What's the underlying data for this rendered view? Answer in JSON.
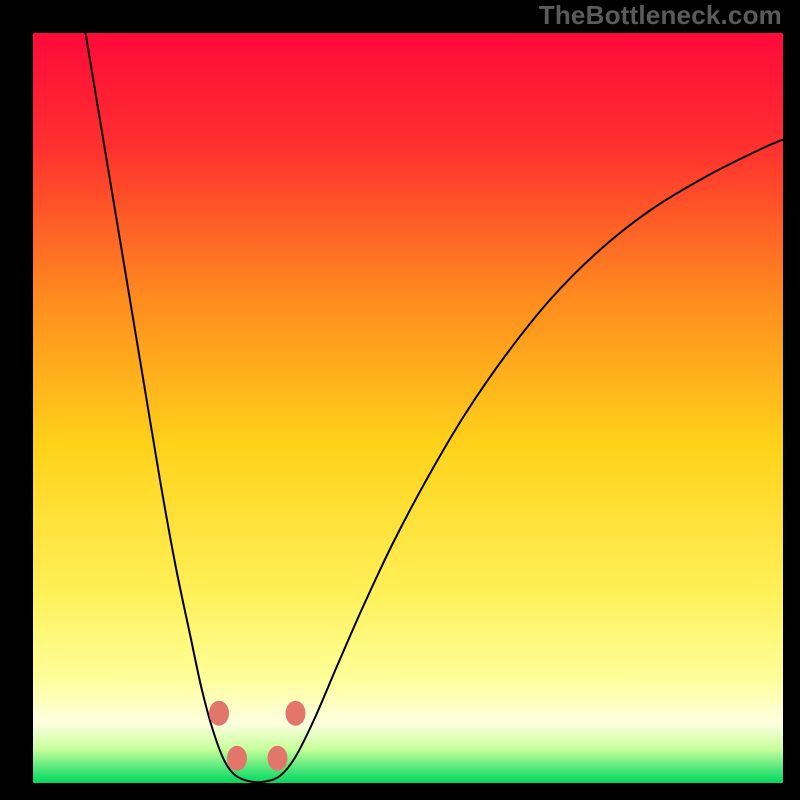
{
  "watermark": "TheBottleneck.com",
  "chart_data": {
    "type": "line",
    "title": "",
    "xlabel": "",
    "ylabel": "",
    "xlim": [
      0,
      100
    ],
    "ylim": [
      0,
      100
    ],
    "background_gradient": {
      "stops": [
        {
          "offset": 0.0,
          "color": "#ff0a3a"
        },
        {
          "offset": 0.15,
          "color": "#ff2f2f"
        },
        {
          "offset": 0.35,
          "color": "#ff8a1f"
        },
        {
          "offset": 0.55,
          "color": "#ffd21a"
        },
        {
          "offset": 0.75,
          "color": "#fff15a"
        },
        {
          "offset": 0.86,
          "color": "#ffff9a"
        },
        {
          "offset": 0.92,
          "color": "#ffffe0"
        },
        {
          "offset": 0.955,
          "color": "#c6ff9a"
        },
        {
          "offset": 0.98,
          "color": "#55e87a"
        },
        {
          "offset": 1.0,
          "color": "#00d860"
        }
      ]
    },
    "series": [
      {
        "name": "bottleneck-curve",
        "color": "#000000",
        "stroke_width": 2,
        "points": [
          {
            "x": 7.0,
            "y": 100.0
          },
          {
            "x": 9.0,
            "y": 88.0
          },
          {
            "x": 11.0,
            "y": 76.0
          },
          {
            "x": 13.0,
            "y": 64.0
          },
          {
            "x": 15.0,
            "y": 52.0
          },
          {
            "x": 17.0,
            "y": 40.0
          },
          {
            "x": 19.0,
            "y": 29.0
          },
          {
            "x": 21.0,
            "y": 19.5
          },
          {
            "x": 22.5,
            "y": 12.5
          },
          {
            "x": 24.0,
            "y": 7.0
          },
          {
            "x": 25.5,
            "y": 3.0
          },
          {
            "x": 27.0,
            "y": 1.0
          },
          {
            "x": 29.0,
            "y": 0.2
          },
          {
            "x": 31.0,
            "y": 0.2
          },
          {
            "x": 33.0,
            "y": 1.0
          },
          {
            "x": 35.0,
            "y": 3.5
          },
          {
            "x": 37.5,
            "y": 8.5
          },
          {
            "x": 40.5,
            "y": 15.5
          },
          {
            "x": 44.0,
            "y": 23.5
          },
          {
            "x": 48.0,
            "y": 32.0
          },
          {
            "x": 52.5,
            "y": 40.5
          },
          {
            "x": 57.5,
            "y": 49.0
          },
          {
            "x": 63.0,
            "y": 57.0
          },
          {
            "x": 69.0,
            "y": 64.5
          },
          {
            "x": 75.5,
            "y": 71.0
          },
          {
            "x": 82.5,
            "y": 76.5
          },
          {
            "x": 90.0,
            "y": 81.0
          },
          {
            "x": 97.0,
            "y": 84.5
          },
          {
            "x": 100.0,
            "y": 85.8
          }
        ]
      }
    ],
    "markers": {
      "name": "highlight-dots",
      "color": "#e2766b",
      "radius_px": 10,
      "points": [
        {
          "x": 24.8,
          "y": 9.3
        },
        {
          "x": 27.2,
          "y": 3.3
        },
        {
          "x": 32.6,
          "y": 3.3
        },
        {
          "x": 35.0,
          "y": 9.3
        }
      ]
    }
  }
}
